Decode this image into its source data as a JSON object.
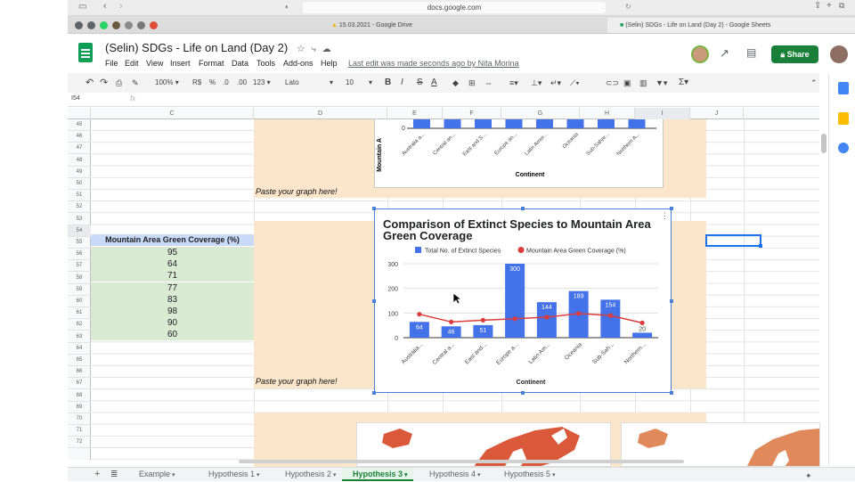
{
  "browser": {
    "url": "docs.google.com",
    "tabs": [
      {
        "label": "15.03.2021 - Google Drive"
      },
      {
        "label": "(Selin) SDGs - Life on Land (Day 2) - Google Sheets"
      }
    ]
  },
  "app": {
    "title": "(Selin) SDGs - Life on Land (Day 2)",
    "menus": [
      "File",
      "Edit",
      "View",
      "Insert",
      "Format",
      "Data",
      "Tools",
      "Add-ons",
      "Help"
    ],
    "last_edit": "Last edit was made seconds ago by Nita Morina",
    "share_label": "Share"
  },
  "toolbar": {
    "zoom": "100%",
    "currency": "R$",
    "percent": "%",
    "dec_less": ".0",
    "dec_more": ".00",
    "format": "123",
    "font": "Lato",
    "font_size": "10",
    "bold": "B",
    "italic": "I",
    "strike": "S",
    "textcolor": "A"
  },
  "formula_bar": {
    "cell_ref": "I54",
    "fx": "fx"
  },
  "columns": [
    "C",
    "D",
    "E",
    "F",
    "G",
    "H",
    "I",
    "J"
  ],
  "rows": [
    "45",
    "46",
    "47",
    "48",
    "49",
    "50",
    "51",
    "52",
    "53",
    "54",
    "55",
    "56",
    "57",
    "58",
    "59",
    "60",
    "61",
    "62",
    "63",
    "64",
    "65",
    "66",
    "67",
    "68",
    "69",
    "70",
    "71",
    "72"
  ],
  "table": {
    "header": "Mountain Area Green Coverage (%)",
    "values": [
      "95",
      "64",
      "71",
      "77",
      "83",
      "98",
      "90",
      "60"
    ]
  },
  "paste_labels": [
    "Paste your graph here!",
    "Paste your graph here!"
  ],
  "top_chart": {
    "ylabel": "Mountain A",
    "ytick": "0",
    "xlabel": "Continent",
    "categories": [
      "Australia a...",
      "Central an...",
      "East and S...",
      "Europe an...",
      "Latin Amer...",
      "Oceania",
      "Sub-Sahar...",
      "Northern A..."
    ]
  },
  "chart_data": {
    "type": "bar",
    "title": "Comparison of Extinct Species to Mountain Area Green Coverage",
    "xlabel": "Continent",
    "ylabel": "",
    "ylim": [
      0,
      300
    ],
    "yticks": [
      "0",
      "100",
      "200",
      "300"
    ],
    "categories": [
      "Australia...",
      "Central a...",
      "East and...",
      "Europe a...",
      "Latin Am...",
      "Oceania",
      "Sub-Sah...",
      "Northern..."
    ],
    "series": [
      {
        "name": "Total No. of Extinct Species",
        "kind": "bar",
        "color": "#4472e8",
        "values": [
          64,
          46,
          51,
          300,
          144,
          189,
          154,
          20
        ]
      },
      {
        "name": "Mountain Area Green Coverage (%)",
        "kind": "line",
        "color": "#dc3c3c",
        "values": [
          95,
          64,
          71,
          77,
          83,
          98,
          90,
          60
        ]
      }
    ],
    "legend": "top",
    "grid": true
  },
  "sheet_tabs": [
    "Example",
    "Hypothesis 1",
    "Hypothesis 2",
    "Hypothesis 3",
    "Hypothesis 4",
    "Hypothesis 5"
  ],
  "active_sheet": "Hypothesis 3",
  "colors": {
    "accent": "#188038",
    "bar": "#4472e8",
    "line": "#dc3c3c",
    "tan": "#fbe6cc",
    "green_cell": "#d9ead3",
    "header_cell": "#c9daf8"
  }
}
